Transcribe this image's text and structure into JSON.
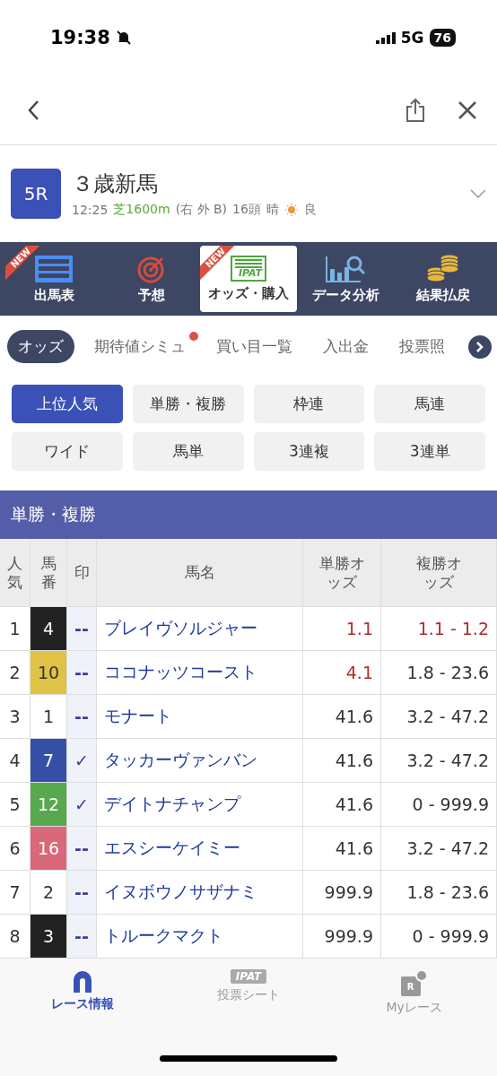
{
  "status_bar": {
    "time": "19:38",
    "network": "5G",
    "battery": "76"
  },
  "race": {
    "number": "5R",
    "title": "３歳新馬",
    "time": "12:25",
    "course": "芝1600m",
    "layout": "(右 外 B)",
    "runners": "16頭",
    "weather": "晴",
    "going": "良"
  },
  "menu": [
    {
      "label": "出馬表",
      "kind": "list",
      "badge": "NEW",
      "selected": false
    },
    {
      "label": "予想",
      "kind": "target",
      "selected": false
    },
    {
      "label": "オッズ・購入",
      "kind": "ipat",
      "icon_text": "IPAT",
      "badge": "NEW",
      "selected": true
    },
    {
      "label": "データ分析",
      "kind": "chart",
      "selected": false
    },
    {
      "label": "結果払戻",
      "kind": "coins",
      "selected": false
    }
  ],
  "sub_tabs": [
    {
      "label": "オッズ",
      "selected": true,
      "dot": false
    },
    {
      "label": "期待値シミュ",
      "selected": false,
      "dot": true
    },
    {
      "label": "買い目一覧",
      "selected": false,
      "dot": false
    },
    {
      "label": "入出金",
      "selected": false,
      "dot": false
    },
    {
      "label": "投票照",
      "selected": false,
      "dot": false
    }
  ],
  "bet_types": [
    {
      "label": "上位人気",
      "selected": true
    },
    {
      "label": "単勝・複勝",
      "selected": false
    },
    {
      "label": "枠連",
      "selected": false
    },
    {
      "label": "馬連",
      "selected": false
    },
    {
      "label": "ワイド",
      "selected": false
    },
    {
      "label": "馬単",
      "selected": false
    },
    {
      "label": "3連複",
      "selected": false
    },
    {
      "label": "3連単",
      "selected": false
    }
  ],
  "section_title": "単勝・複勝",
  "table": {
    "columns": [
      "人気",
      "馬番",
      "印",
      "馬名",
      "単勝オッズ",
      "複勝オッズ"
    ],
    "rows": [
      {
        "rank": "1",
        "number": "4",
        "color": "#222222",
        "mark": "--",
        "name": "ブレイヴソルジャー",
        "win": "1.1",
        "place": "1.1 - 1.2",
        "win_hot": true,
        "place_hot": true
      },
      {
        "rank": "2",
        "number": "10",
        "color": "#e0c245",
        "mark": "--",
        "name": "ココナッツコースト",
        "win": "4.1",
        "place": "1.8 - 23.6",
        "win_hot": true,
        "place_hot": false
      },
      {
        "rank": "3",
        "number": "1",
        "color": "#ffffff",
        "mark": "--",
        "name": "モナート",
        "win": "41.6",
        "place": "3.2 - 47.2",
        "win_hot": false,
        "place_hot": false
      },
      {
        "rank": "4",
        "number": "7",
        "color": "#3550a6",
        "mark": "✓",
        "name": "タッカーヴァンバン",
        "win": "41.6",
        "place": "3.2 - 47.2",
        "win_hot": false,
        "place_hot": false
      },
      {
        "rank": "5",
        "number": "12",
        "color": "#58a84e",
        "mark": "✓",
        "name": "デイトナチャンプ",
        "win": "41.6",
        "place": "0 - 999.9",
        "win_hot": false,
        "place_hot": false
      },
      {
        "rank": "6",
        "number": "16",
        "color": "#d9687a",
        "mark": "--",
        "name": "エスシーケイミー",
        "win": "41.6",
        "place": "3.2 - 47.2",
        "win_hot": false,
        "place_hot": false
      },
      {
        "rank": "7",
        "number": "2",
        "color": "#ffffff",
        "mark": "--",
        "name": "イヌボウノサザナミ",
        "win": "999.9",
        "place": "1.8 - 23.6",
        "win_hot": false,
        "place_hot": false
      },
      {
        "rank": "8",
        "number": "3",
        "color": "#222222",
        "mark": "--",
        "name": "トルークマクト",
        "win": "999.9",
        "place": "0 - 999.9",
        "win_hot": false,
        "place_hot": false
      }
    ]
  },
  "bottom_tabs": [
    {
      "label": "レース情報",
      "kind": "horseshoe",
      "selected": true
    },
    {
      "label": "投票シート",
      "kind": "ipat",
      "icon_text": "IPAT",
      "selected": false
    },
    {
      "label": "Myレース",
      "kind": "myrace",
      "icon_text": "R",
      "selected": false
    }
  ]
}
